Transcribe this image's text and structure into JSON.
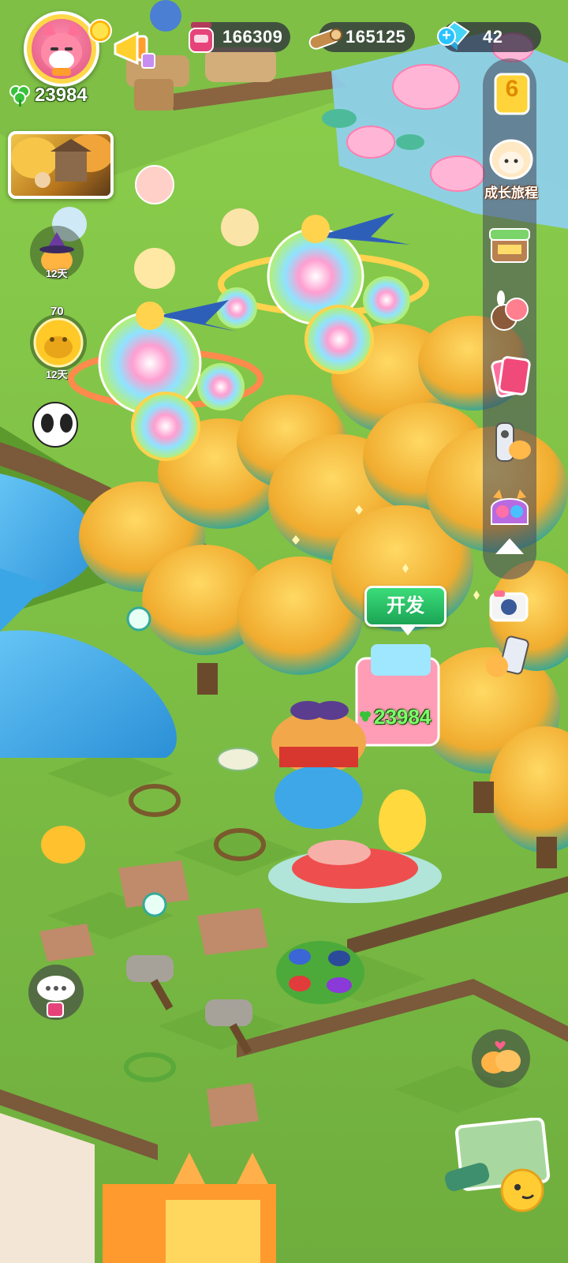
{
  "hud": {
    "player_avatar": "fox-avatar",
    "clover_count": "23984",
    "resources": [
      {
        "name": "jam",
        "icon": "jam-jar-icon",
        "value": "166309",
        "color": "#e5437a"
      },
      {
        "name": "wood",
        "icon": "wood-log-icon",
        "value": "165125",
        "color": "#b07a3a"
      },
      {
        "name": "gems",
        "icon": "gem-icon",
        "value": "42",
        "color": "#3ec9f0",
        "has_plus": true
      }
    ]
  },
  "timers": [
    {
      "label": "12天",
      "icon": "witch-animal-icon"
    },
    {
      "value": "70",
      "label": "12天",
      "icon": "golden-cat-icon"
    }
  ],
  "side_menu": {
    "top_badge": "6",
    "top_banner": "成长旅程",
    "items": [
      "shop-stall-icon",
      "animal-friends-icon",
      "cards-icon",
      "remote-icon",
      "gift-pack-icon"
    ],
    "collapse_icon": "triangle-up-icon",
    "extras": [
      "camera-icon",
      "phone-icon"
    ]
  },
  "scene": {
    "develop_label": "开发",
    "floating_score": "23984"
  },
  "bottom_right": [
    "chicks-icon",
    "map-telescope-icon"
  ],
  "colors": {
    "grass": "#6fae3e",
    "grass_dark": "#5f9a32",
    "river": "#3aa6e6",
    "tree_gold": "#f2b53a"
  }
}
